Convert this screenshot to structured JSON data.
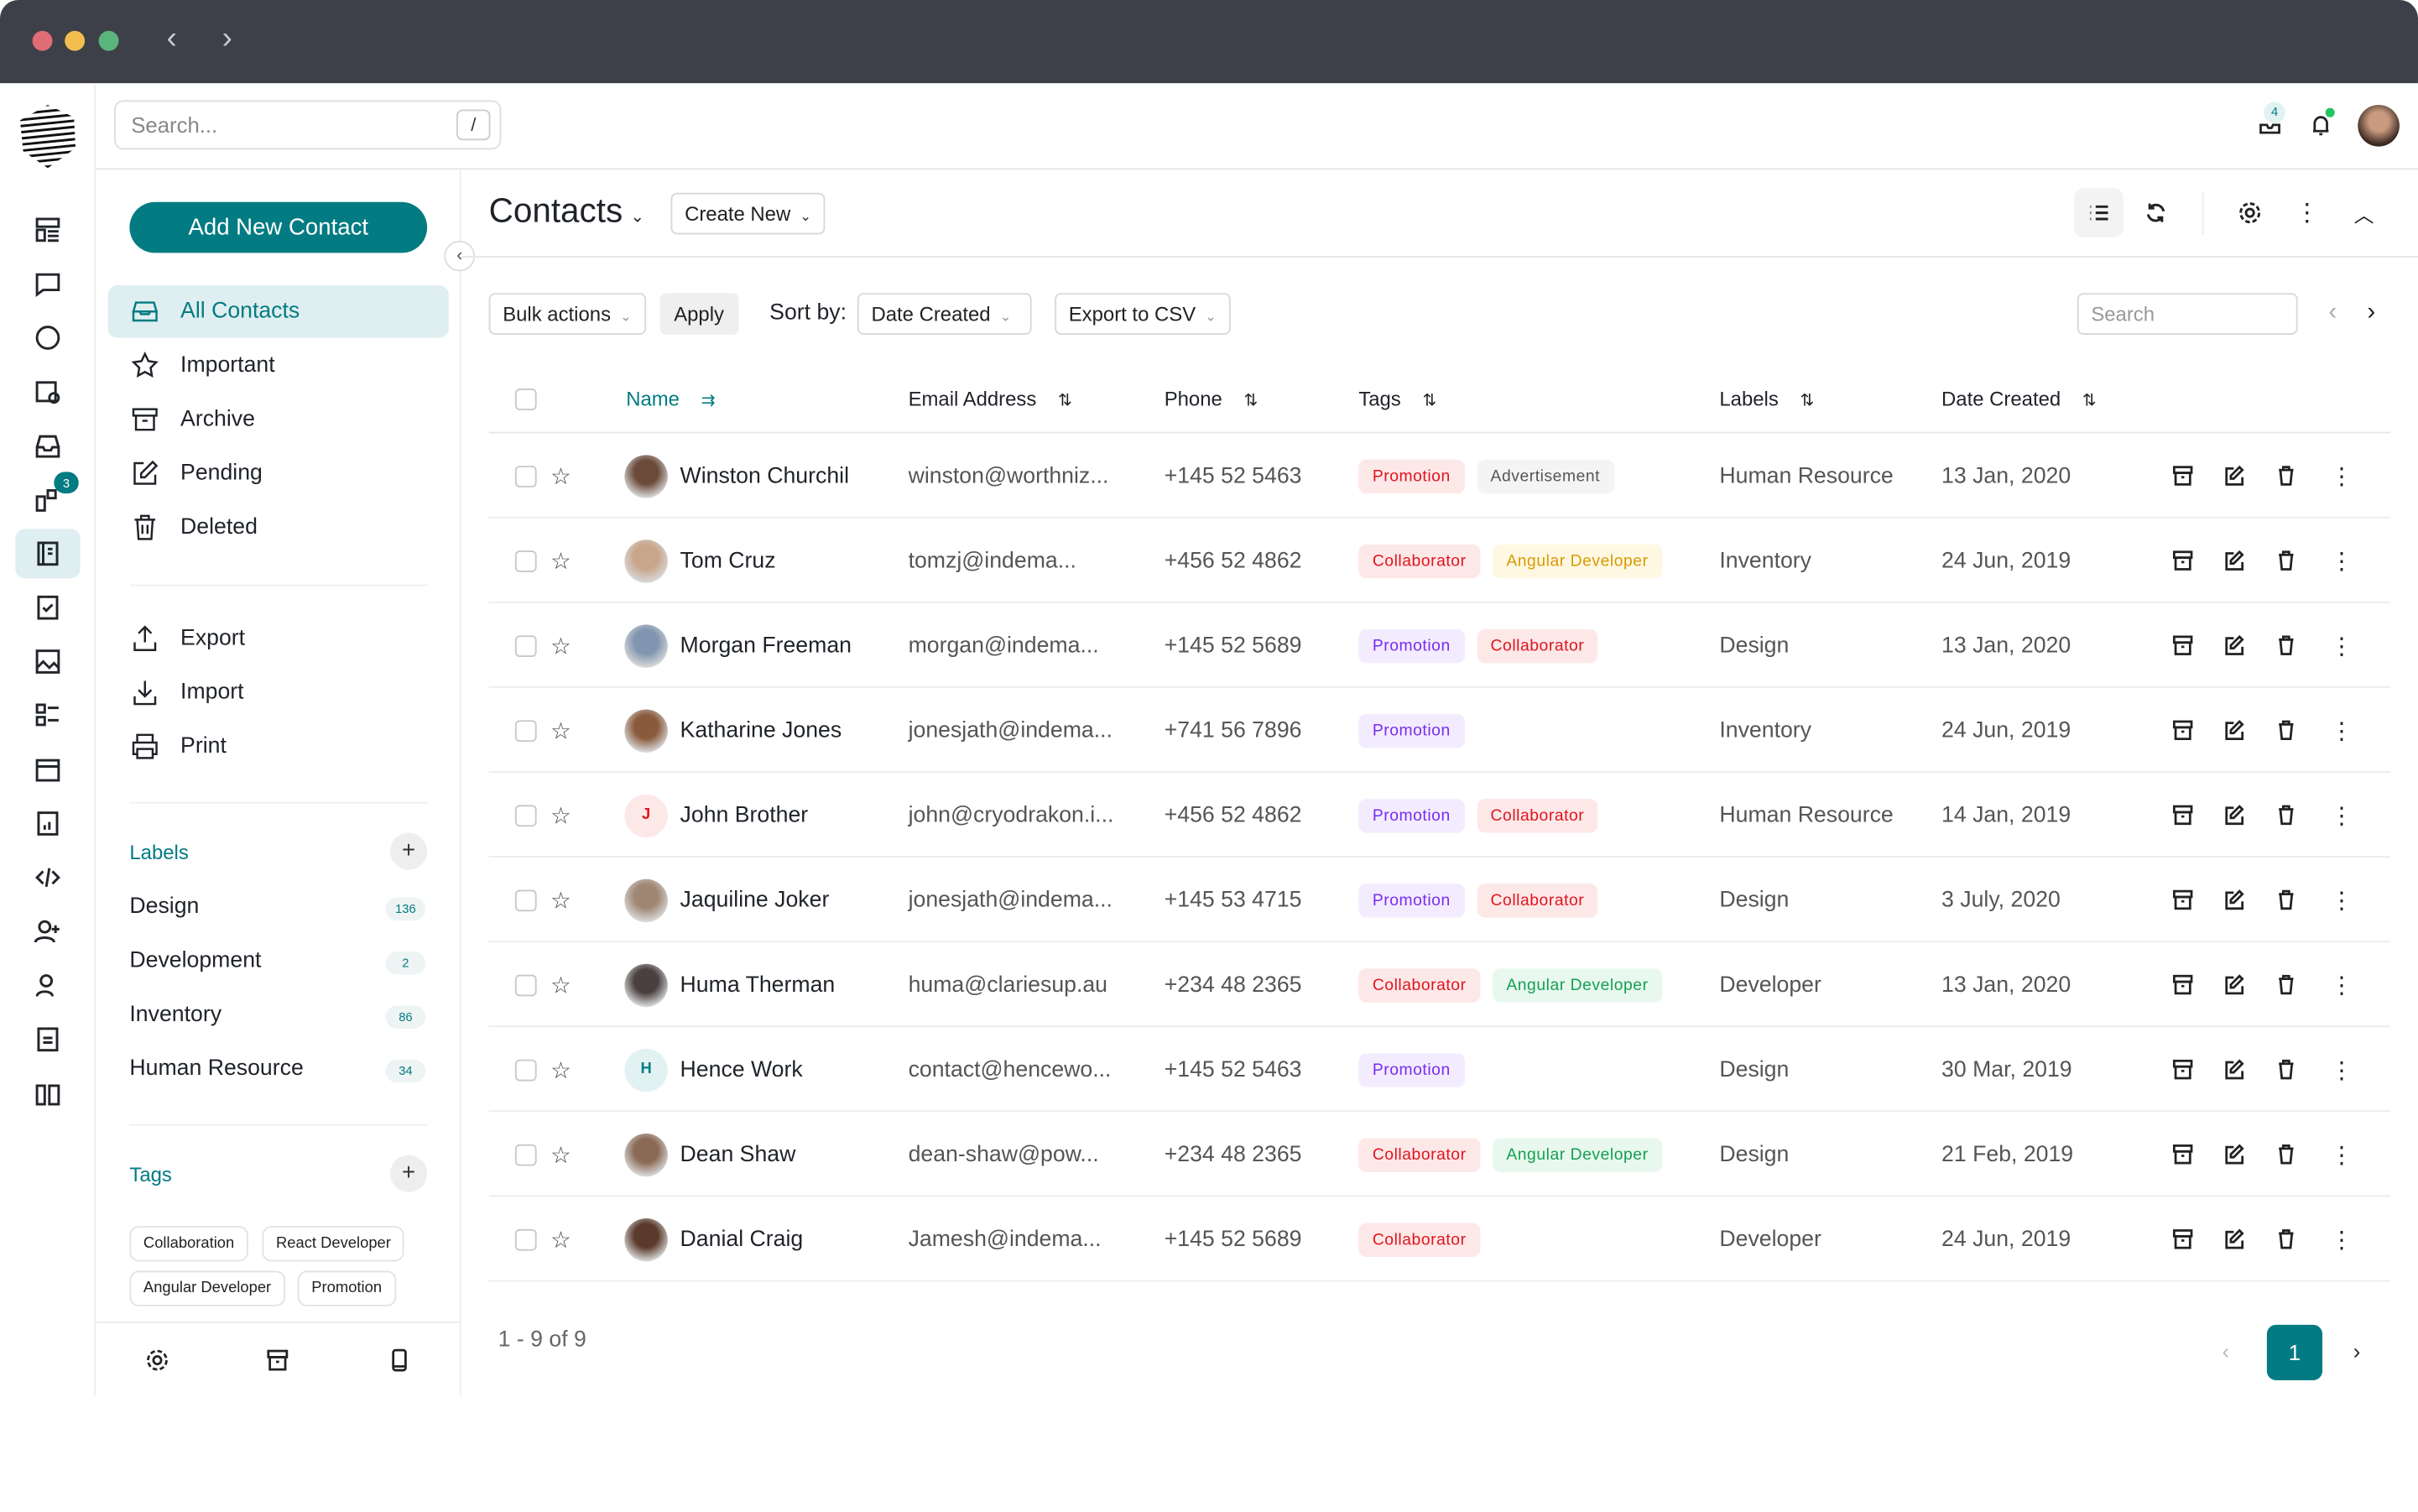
{
  "window": {
    "back_icon": "chevron-left",
    "forward_icon": "chevron-right"
  },
  "header": {
    "search_placeholder": "Search...",
    "search_shortcut": "/",
    "inbox_count": "4"
  },
  "rail": {
    "icons": [
      "dashboard",
      "chat",
      "message-circle",
      "calendar-clock",
      "inbox",
      "kanban",
      "contacts-book",
      "file-check",
      "image",
      "list",
      "calendar",
      "file-chart",
      "code",
      "user-plus",
      "user-search",
      "file-doc",
      "layout"
    ],
    "active": "contacts-book",
    "kanban_badge": "3"
  },
  "sidebar": {
    "add_button": "Add New Contact",
    "nav": [
      {
        "label": "All Contacts",
        "icon": "inbox",
        "active": true
      },
      {
        "label": "Important",
        "icon": "star"
      },
      {
        "label": "Archive",
        "icon": "archive"
      },
      {
        "label": "Pending",
        "icon": "edit"
      },
      {
        "label": "Deleted",
        "icon": "trash"
      }
    ],
    "actions": [
      {
        "label": "Export",
        "icon": "upload"
      },
      {
        "label": "Import",
        "icon": "download"
      },
      {
        "label": "Print",
        "icon": "printer"
      }
    ],
    "labels_title": "Labels",
    "labels": [
      {
        "name": "Design",
        "count": "136"
      },
      {
        "name": "Development",
        "count": "2"
      },
      {
        "name": "Inventory",
        "count": "86"
      },
      {
        "name": "Human Resource",
        "count": "34"
      }
    ],
    "tags_title": "Tags",
    "tags": [
      "Collaboration",
      "React Developer",
      "Angular Developer",
      "Promotion"
    ]
  },
  "main": {
    "title": "Contacts",
    "create_new": "Create New",
    "bulk_actions": "Bulk actions",
    "apply": "Apply",
    "sort_by": "Sort by:",
    "sort_value": "Date Created",
    "export": "Export to CSV",
    "search_placeholder": "Search",
    "columns": [
      "Name",
      "Email Address",
      "Phone",
      "Tags",
      "Labels",
      "Date Created"
    ],
    "rows": [
      {
        "name": "Winston Churchil",
        "email": "winston@worthniz...",
        "phone": "+145 52 5463",
        "tags": [
          {
            "text": "Promotion",
            "color": "red"
          },
          {
            "text": "Advertisement",
            "color": "gray"
          }
        ],
        "label": "Human Resource",
        "date": "13 Jan, 2020",
        "avatar": "#6b4a3a"
      },
      {
        "name": "Tom Cruz",
        "email": "tomzj@indema...",
        "phone": "+456 52 4862",
        "tags": [
          {
            "text": "Collaborator",
            "color": "red"
          },
          {
            "text": "Angular Developer",
            "color": "yellow"
          }
        ],
        "label": "Inventory",
        "date": "24 Jun, 2019",
        "avatar": "#c9a58a"
      },
      {
        "name": "Morgan Freeman",
        "email": "morgan@indema...",
        "phone": "+145 52 5689",
        "tags": [
          {
            "text": "Promotion",
            "color": "purple"
          },
          {
            "text": "Collaborator",
            "color": "red"
          }
        ],
        "label": "Design",
        "date": "13 Jan, 2020",
        "avatar": "#7f95b0"
      },
      {
        "name": "Katharine Jones",
        "email": "jonesjath@indema...",
        "phone": "+741 56 7896",
        "tags": [
          {
            "text": "Promotion",
            "color": "purple"
          }
        ],
        "label": "Inventory",
        "date": "24 Jun, 2019",
        "avatar": "#8a5a3c"
      },
      {
        "name": "John Brother",
        "email": "john@cryodrakon.i...",
        "phone": "+456 52 4862",
        "tags": [
          {
            "text": "Promotion",
            "color": "purple"
          },
          {
            "text": "Collaborator",
            "color": "red"
          }
        ],
        "label": "Human Resource",
        "date": "14 Jan, 2019",
        "initial": "J"
      },
      {
        "name": "Jaquiline Joker",
        "email": "jonesjath@indema...",
        "phone": "+145 53 4715",
        "tags": [
          {
            "text": "Promotion",
            "color": "purple"
          },
          {
            "text": "Collaborator",
            "color": "red"
          }
        ],
        "label": "Design",
        "date": "3 July, 2020",
        "avatar": "#a08774"
      },
      {
        "name": "Huma Therman",
        "email": "huma@clariesup.au",
        "phone": "+234 48 2365",
        "tags": [
          {
            "text": "Collaborator",
            "color": "red"
          },
          {
            "text": "Angular Developer",
            "color": "green"
          }
        ],
        "label": "Developer",
        "date": "13 Jan, 2020",
        "avatar": "#4a4040"
      },
      {
        "name": "Hence Work",
        "email": "contact@hencewo...",
        "phone": "+145 52 5463",
        "tags": [
          {
            "text": "Promotion",
            "color": "purple"
          }
        ],
        "label": "Design",
        "date": "30 Mar, 2019",
        "initial": "H"
      },
      {
        "name": "Dean Shaw",
        "email": "dean-shaw@pow...",
        "phone": "+234 48 2365",
        "tags": [
          {
            "text": "Collaborator",
            "color": "red"
          },
          {
            "text": "Angular Developer",
            "color": "green"
          }
        ],
        "label": "Design",
        "date": "21 Feb, 2019",
        "avatar": "#8b6a55"
      },
      {
        "name": "Danial Craig",
        "email": "Jamesh@indema...",
        "phone": "+145 52 5689",
        "tags": [
          {
            "text": "Collaborator",
            "color": "red"
          }
        ],
        "label": "Developer",
        "date": "24 Jun, 2019",
        "avatar": "#5a3a2a"
      }
    ],
    "pagination": {
      "summary": "1 - 9 of 9",
      "current": "1"
    }
  },
  "colors": {
    "accent": "#037b82",
    "titlebar": "#3d4049"
  }
}
